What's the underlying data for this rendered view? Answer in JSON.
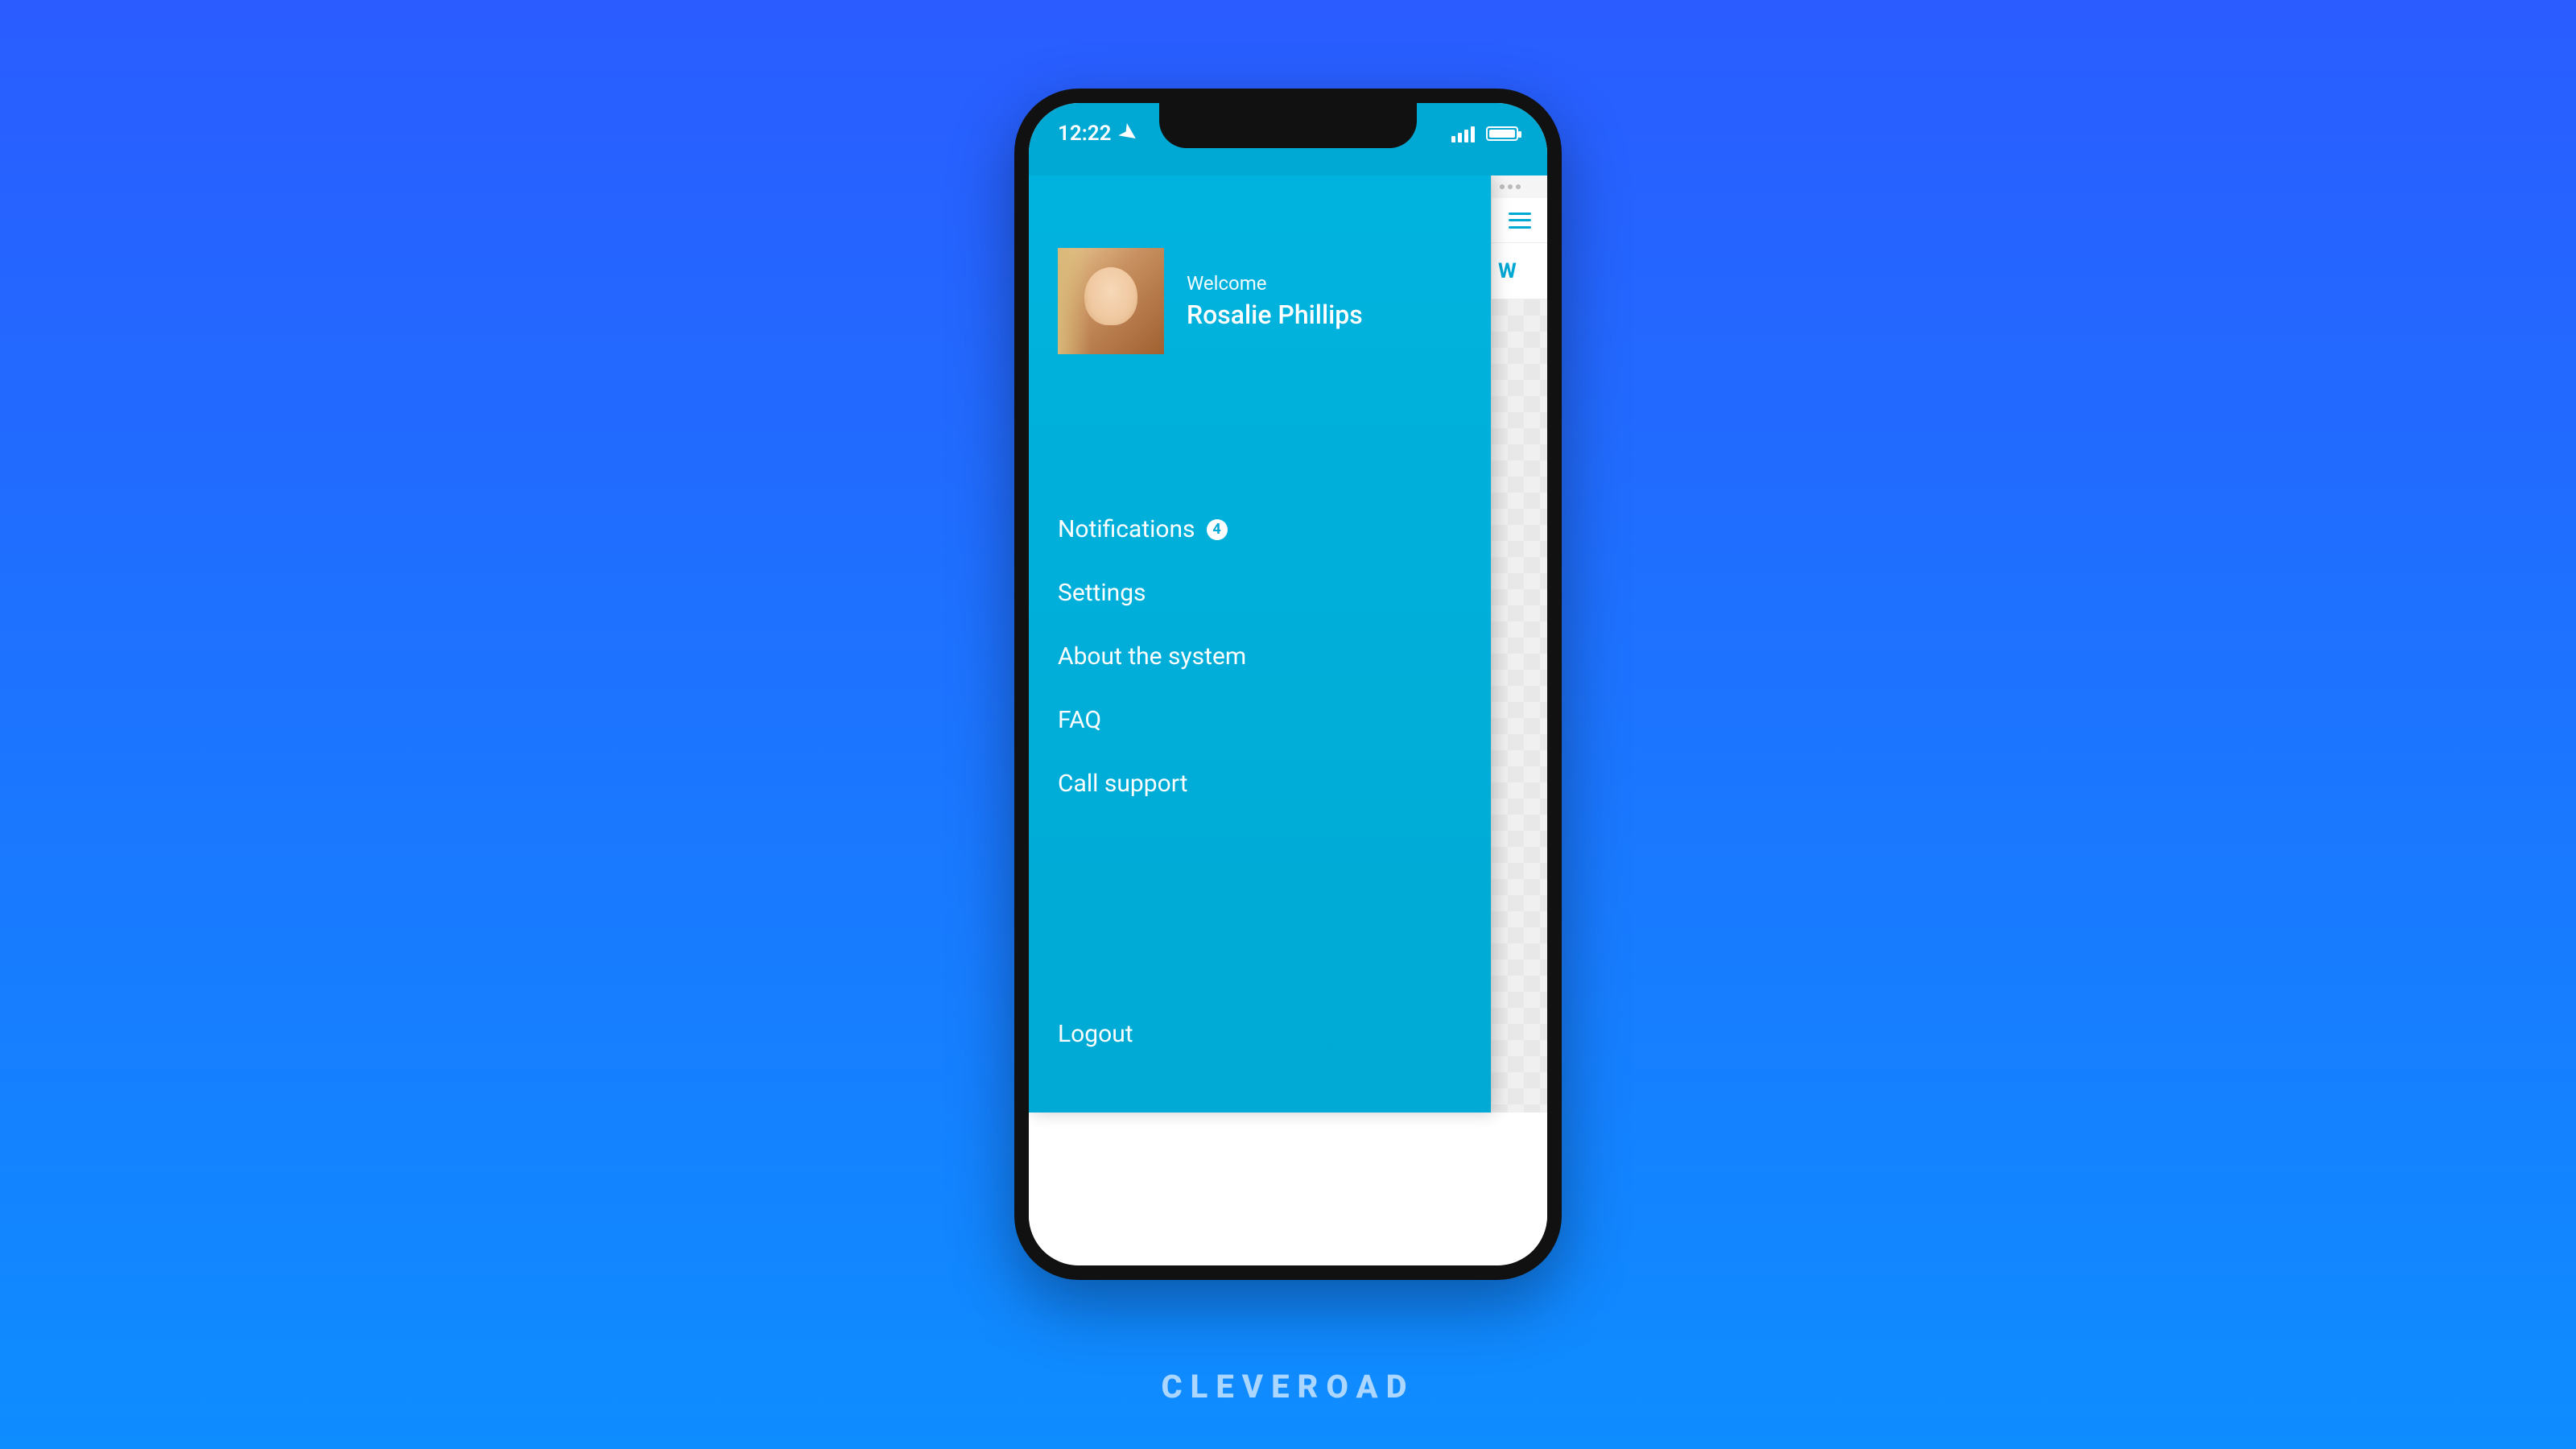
{
  "status": {
    "time": "12:22",
    "location_icon": "location-arrow"
  },
  "profile": {
    "welcome_label": "Welcome",
    "username": "Rosalie Phillips"
  },
  "menu": {
    "items": [
      {
        "label": "Notifications",
        "badge": "4"
      },
      {
        "label": "Settings"
      },
      {
        "label": "About the system"
      },
      {
        "label": "FAQ"
      },
      {
        "label": "Call support"
      }
    ],
    "logout_label": "Logout"
  },
  "peek": {
    "partial_label": "W"
  },
  "brand": "CLEVEROAD"
}
